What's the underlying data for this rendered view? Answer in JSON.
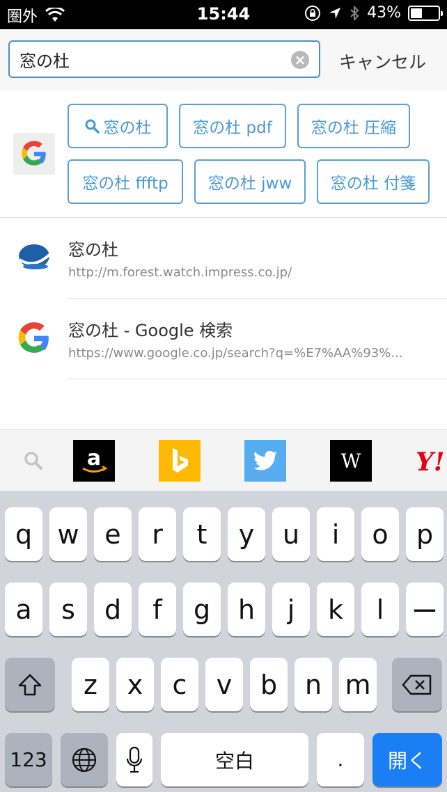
{
  "status_bar": {
    "carrier": "圏外",
    "time": "15:44",
    "battery": "43%",
    "battery_level": 0.43
  },
  "search": {
    "query": "窓の杜",
    "cancel_label": "キャンセル"
  },
  "suggestions": [
    {
      "label": "窓の杜",
      "has_search_icon": true
    },
    {
      "label": "窓の杜 pdf"
    },
    {
      "label": "窓の杜 圧縮"
    },
    {
      "label": "窓の杜 ffftp"
    },
    {
      "label": "窓の杜 jww"
    },
    {
      "label": "窓の杜 付箋"
    }
  ],
  "history": [
    {
      "title": "窓の杜",
      "url": "http://m.forest.watch.impress.co.jp/",
      "icon": "forest-logo-icon"
    },
    {
      "title": "窓の杜 - Google 検索",
      "url": "https://www.google.co.jp/search?q=%E7%AA%93%...",
      "icon": "google-icon"
    }
  ],
  "engines": [
    "search-icon",
    "amazon-icon",
    "bing-icon",
    "twitter-icon",
    "wikipedia-icon",
    "yahoo-icon"
  ],
  "keyboard": {
    "row1": [
      "q",
      "w",
      "e",
      "r",
      "t",
      "y",
      "u",
      "i",
      "o",
      "p"
    ],
    "row2": [
      "a",
      "s",
      "d",
      "f",
      "g",
      "h",
      "j",
      "k",
      "l",
      "ー"
    ],
    "row3": [
      "z",
      "x",
      "c",
      "v",
      "b",
      "n",
      "m"
    ],
    "numbers_label": "123",
    "space_label": "空白",
    "period_label": ".",
    "go_label": "開く"
  },
  "colors": {
    "accent": "#4a98d4",
    "keyboard_bg": "#d1d4da",
    "go_key": "#1a7ef5"
  }
}
